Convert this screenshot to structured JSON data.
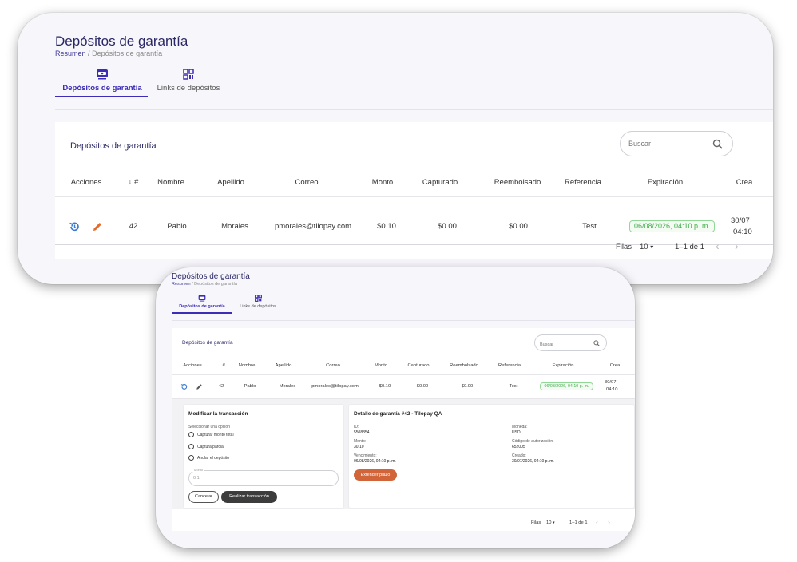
{
  "page": {
    "title": "Depósitos de garantía",
    "breadcrumb": {
      "root": "Resumen",
      "separator": "/",
      "current": "Depósitos de garantía"
    },
    "tabs": [
      {
        "label": "Depósitos de garantía",
        "icon": "wallet-icon",
        "active": true
      },
      {
        "label": "Links de depósitos",
        "icon": "qr-code-icon",
        "active": false
      }
    ]
  },
  "table": {
    "title": "Depósitos de garantía",
    "search_placeholder": "Buscar",
    "sort_arrow": "↓",
    "columns": [
      "Acciones",
      "#",
      "Nombre",
      "Apellido",
      "Correo",
      "Monto",
      "Capturado",
      "Reembolsado",
      "Referencia",
      "Expiración",
      "Crea"
    ],
    "rows": [
      {
        "id": "42",
        "nombre": "Pablo",
        "apellido": "Morales",
        "correo": "pmorales@tilopay.com",
        "monto": "$0.10",
        "capturado": "$0.00",
        "reembolsado": "$0.00",
        "referencia": "Test",
        "expiracion": "06/08/2026, 04:10 p. m.",
        "creado_1": "30/07",
        "creado_2": "04:10"
      }
    ],
    "pagination": {
      "rows_label": "Filas",
      "rows_per_page": "10",
      "range": "1–1 de 1",
      "prev": "‹",
      "next": "›",
      "dropdown": "▾"
    }
  },
  "detail": {
    "modify": {
      "title": "Modificar la transacción",
      "prompt": "Seleccionar una opción",
      "options": [
        "Capturar monto total",
        "Captura parcial",
        "Anular el depósito"
      ],
      "amount_label": "Monto",
      "amount_value": "0.1",
      "cancel_label": "Cancelar",
      "submit_label": "Realizar transacción"
    },
    "info": {
      "title": "Detalle de garantía #42 - Tilopay QA",
      "id_label": "ID:",
      "id_value": "5508854",
      "amount_label": "Monto:",
      "amount_value": "30.10",
      "due_label": "Vencimiento:",
      "due_value": "06/08/2026, 04:10 p. m.",
      "currency_label": "Moneda:",
      "currency_value": "USD",
      "auth_label": "Código de autorización:",
      "auth_value": "652005",
      "created_label": "Creado:",
      "created_value": "30/07/2026, 04:10 p. m.",
      "extend_label": "Extender plazo"
    }
  },
  "colors": {
    "brand": "#2a2766",
    "accent": "#3b2db8",
    "history": "#3a7bd5",
    "edit": "#e36b2c",
    "success": "#3fae4a",
    "orange_button": "#d2643a"
  }
}
